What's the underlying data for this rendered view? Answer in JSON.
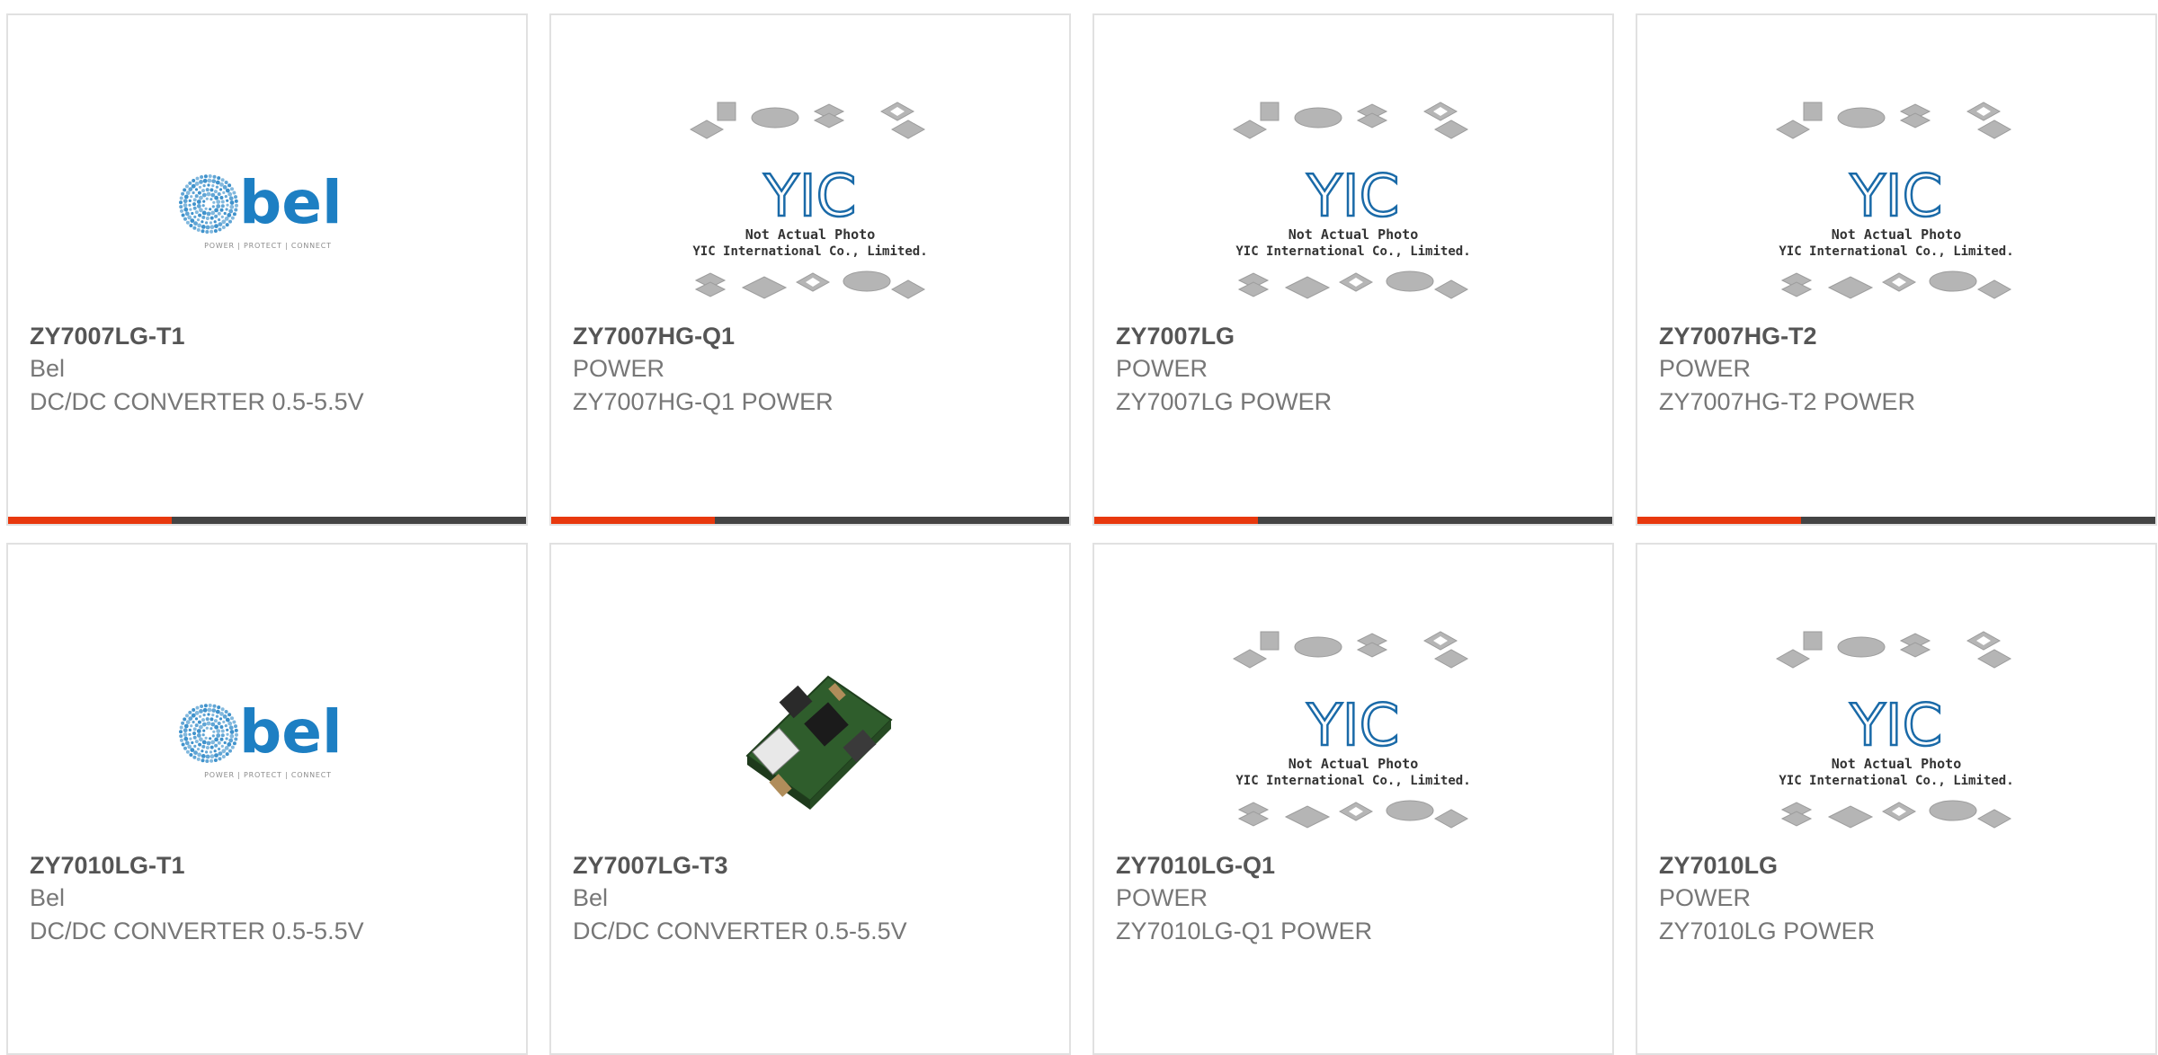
{
  "colors": {
    "accent": "#e8380d",
    "dark_bar": "#444444",
    "bel_blue": "#1d7fc3",
    "yic_blue": "#1a6aa8",
    "chip_gray": "#b5b5b5"
  },
  "products": [
    {
      "part_number": "ZY7007LG-T1",
      "brand": "Bel",
      "description": "DC/DC CONVERTER 0.5-5.5V",
      "image": "bel-logo",
      "logo_text": "bel",
      "logo_tagline": "POWER | PROTECT | CONNECT",
      "show_accent_bar": true
    },
    {
      "part_number": "ZY7007HG-Q1",
      "brand": "POWER",
      "description": "ZY7007HG-Q1 POWER",
      "image": "yic-placeholder",
      "logo_text": "YIC",
      "caption_line1": "Not Actual Photo",
      "caption_line2": "YIC International Co., Limited.",
      "show_accent_bar": true
    },
    {
      "part_number": "ZY7007LG",
      "brand": "POWER",
      "description": "ZY7007LG POWER",
      "image": "yic-placeholder",
      "logo_text": "YIC",
      "caption_line1": "Not Actual Photo",
      "caption_line2": "YIC International Co., Limited.",
      "show_accent_bar": true
    },
    {
      "part_number": "ZY7007HG-T2",
      "brand": "POWER",
      "description": "ZY7007HG-T2 POWER",
      "image": "yic-placeholder",
      "logo_text": "YIC",
      "caption_line1": "Not Actual Photo",
      "caption_line2": "YIC International Co., Limited.",
      "show_accent_bar": true
    },
    {
      "part_number": "ZY7010LG-T1",
      "brand": "Bel",
      "description": "DC/DC CONVERTER 0.5-5.5V",
      "image": "bel-logo",
      "logo_text": "bel",
      "logo_tagline": "POWER | PROTECT | CONNECT",
      "show_accent_bar": false
    },
    {
      "part_number": "ZY7007LG-T3",
      "brand": "Bel",
      "description": "DC/DC CONVERTER 0.5-5.5V",
      "image": "module-photo",
      "show_accent_bar": false
    },
    {
      "part_number": "ZY7010LG-Q1",
      "brand": "POWER",
      "description": "ZY7010LG-Q1 POWER",
      "image": "yic-placeholder",
      "logo_text": "YIC",
      "caption_line1": "Not Actual Photo",
      "caption_line2": "YIC International Co., Limited.",
      "show_accent_bar": false
    },
    {
      "part_number": "ZY7010LG",
      "brand": "POWER",
      "description": "ZY7010LG POWER",
      "image": "yic-placeholder",
      "logo_text": "YIC",
      "caption_line1": "Not Actual Photo",
      "caption_line2": "YIC International Co., Limited.",
      "show_accent_bar": false
    }
  ]
}
